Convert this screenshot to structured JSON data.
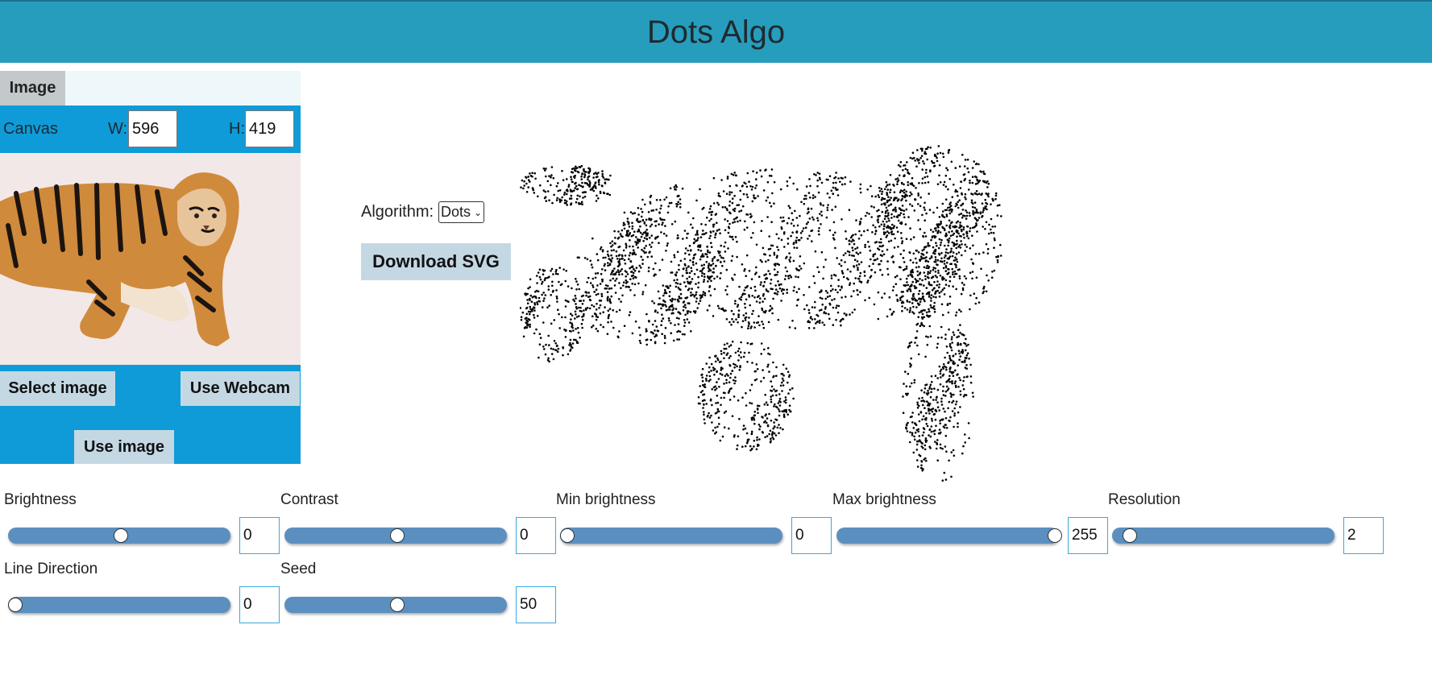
{
  "header": {
    "title": "Dots Algo"
  },
  "panel": {
    "tab_label": "Image",
    "canvas_label": "Canvas",
    "width_label": "W:",
    "width_value": "596",
    "height_label": "H:",
    "height_value": "419",
    "select_image_label": "Select image",
    "webcam_label": "Use Webcam",
    "use_image_label": "Use image"
  },
  "controls": {
    "algorithm_label": "Algorithm:",
    "algorithm_value": "Dots",
    "download_label": "Download SVG"
  },
  "sliders": [
    {
      "label": "Brightness",
      "value": "0",
      "fraction": 0.5
    },
    {
      "label": "Contrast",
      "value": "0",
      "fraction": 0.5
    },
    {
      "label": "Min brightness",
      "value": "0",
      "fraction": 0.0
    },
    {
      "label": "Max brightness",
      "value": "255",
      "fraction": 1.0
    },
    {
      "label": "Resolution",
      "value": "2",
      "fraction": 0.05
    },
    {
      "label": "Line Direction",
      "value": "0",
      "fraction": 0.0
    },
    {
      "label": "Seed",
      "value": "50",
      "fraction": 0.5
    }
  ],
  "colors": {
    "header": "#279dbd",
    "panel_blue": "#0f9bd8",
    "button": "#c4d8e4",
    "slider_track": "#5b8fbf"
  }
}
